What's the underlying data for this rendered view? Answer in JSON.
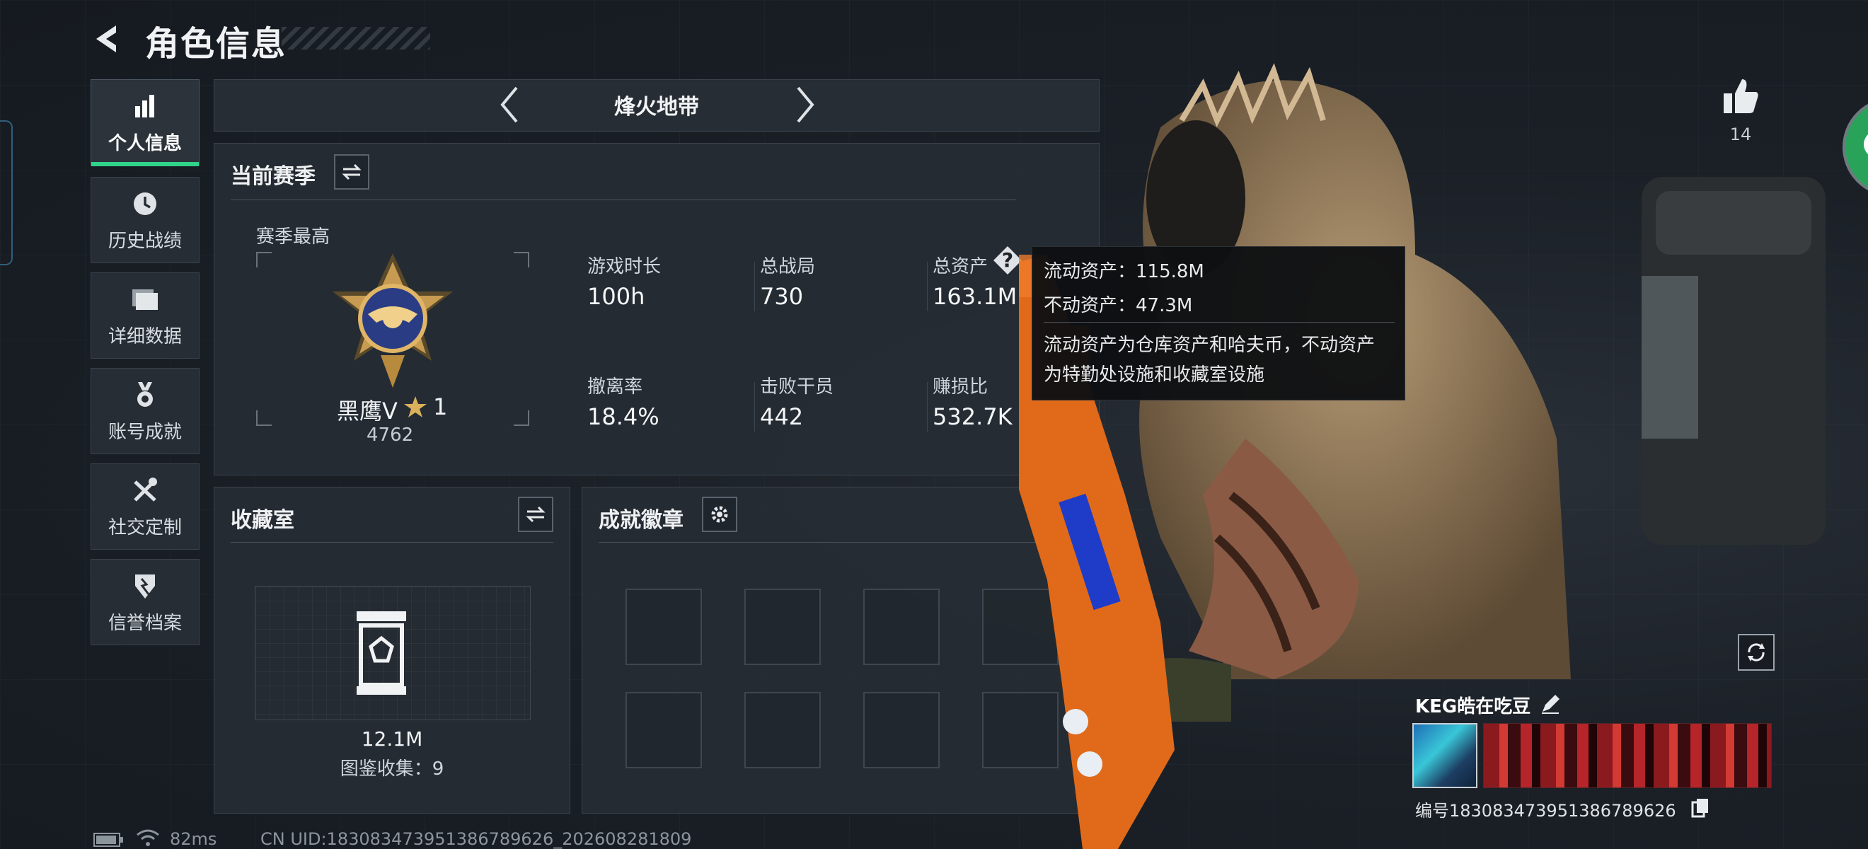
{
  "header": {
    "title": "角色信息"
  },
  "sidebar": {
    "items": [
      {
        "label": "个人信息",
        "icon": "bar-chart-icon",
        "active": true
      },
      {
        "label": "历史战绩",
        "icon": "clock-icon",
        "active": false
      },
      {
        "label": "详细数据",
        "icon": "folder-icon",
        "active": false
      },
      {
        "label": "账号成就",
        "icon": "medal-icon",
        "active": false
      },
      {
        "label": "社交定制",
        "icon": "tools-icon",
        "active": false
      },
      {
        "label": "信誉档案",
        "icon": "shield-icon",
        "active": false
      }
    ]
  },
  "mode": {
    "name": "烽火地带"
  },
  "season": {
    "title": "当前赛季",
    "best_label": "赛季最高",
    "rank_name": "黑鹰V",
    "rank_star": "1",
    "rank_score": "4762",
    "stats": [
      {
        "label": "游戏时长",
        "value": "100h"
      },
      {
        "label": "总战局",
        "value": "730"
      },
      {
        "label": "总资产",
        "value": "163.1M"
      },
      {
        "label": "撤离率",
        "value": "18.4%"
      },
      {
        "label": "击败干员",
        "value": "442"
      },
      {
        "label": "赚损比",
        "value": "532.7K"
      }
    ]
  },
  "tooltip": {
    "liquid": "流动资产：115.8M",
    "fixed": "不动资产：47.3M",
    "desc1": "流动资产为仓库资产和哈夫币，不动资产",
    "desc2": "为特勤处设施和收藏室设施"
  },
  "collection": {
    "title": "收藏室",
    "value": "12.1M",
    "count": "图鉴收集：9"
  },
  "badges": {
    "title": "成就徽章"
  },
  "profile": {
    "likes": "14",
    "player_name": "KEG皓在吃豆",
    "uid_label": "编号18308347395138678962​6"
  },
  "status": {
    "ping": "82ms",
    "uid": "CN UID:18308347395138678962​6_202608281809"
  },
  "colors": {
    "accent": "#2fd48a",
    "panel": "#262c34",
    "tooltip_bg": "#0e1012"
  }
}
